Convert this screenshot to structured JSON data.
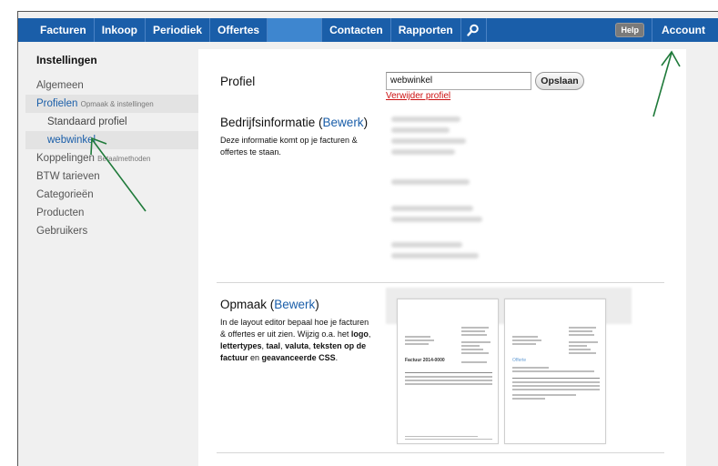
{
  "nav": {
    "items": [
      "Facturen",
      "Inkoop",
      "Periodiek",
      "Offertes"
    ],
    "items_right": [
      "Contacten",
      "Rapporten"
    ],
    "help": "Help",
    "account": "Account"
  },
  "sidebar": {
    "heading": "Instellingen",
    "items": [
      {
        "label": "Algemeen"
      },
      {
        "label": "Profielen",
        "sub": "Opmaak & instellingen"
      },
      {
        "label": "Standaard profiel"
      },
      {
        "label": "webwinkel"
      },
      {
        "label": "Koppelingen",
        "sub": "Betaalmethoden"
      },
      {
        "label": "BTW tarieven"
      },
      {
        "label": "Categorieën"
      },
      {
        "label": "Producten"
      },
      {
        "label": "Gebruikers"
      }
    ]
  },
  "profile": {
    "label": "Profiel",
    "input_value": "webwinkel",
    "save_label": "Opslaan",
    "delete_label": "Verwijder profiel"
  },
  "company": {
    "title": "Bedrijfsinformatie",
    "edit": "Bewerk",
    "desc": "Deze informatie komt op je facturen & offertes te staan."
  },
  "layout": {
    "title": "Opmaak",
    "edit": "Bewerk",
    "desc_1": "In de layout editor bepaal hoe je facturen & offertes er uit zien. Wijzig o.a. het ",
    "b_logo": "logo",
    "desc_2": ", ",
    "b_fonts": "lettertypes",
    "b_taal": "taal",
    "b_valuta": "valuta",
    "b_teksten": "teksten op de factuur",
    "desc_en": " en ",
    "b_css": "geavanceerde CSS",
    "desc_end": "."
  },
  "previews": {
    "invoice_title": "Factuur 2014-0000",
    "quote_title": "Offerte"
  },
  "colors": {
    "nav_bg": "#1a5ea9",
    "link": "#1a5ea9",
    "delete": "#cc1111",
    "arrow": "#1f7a3a"
  }
}
